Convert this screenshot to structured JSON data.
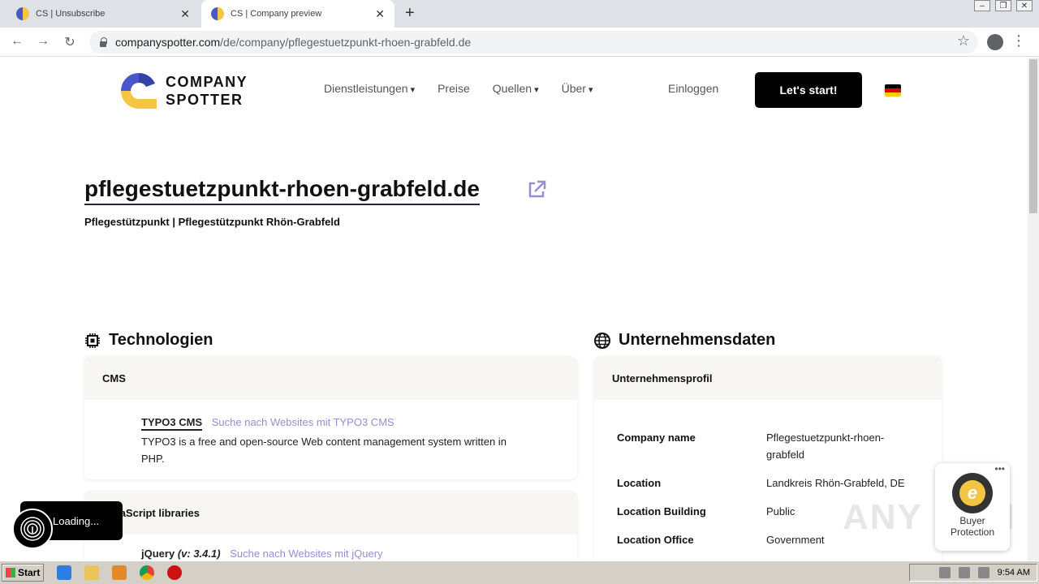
{
  "browser": {
    "tabs": [
      {
        "title": "CS | Unsubscribe"
      },
      {
        "title": "CS | Company preview"
      }
    ],
    "url_host": "companyspotter.com",
    "url_path": "/de/company/pflegestuetzpunkt-rhoen-grabfeld.de"
  },
  "header": {
    "logo_line1": "COMPANY",
    "logo_line2": "SPOTTER",
    "nav": {
      "services": "Dienstleistungen",
      "pricing": "Preise",
      "sources": "Quellen",
      "about": "Über"
    },
    "login": "Einloggen",
    "cta": "Let's start!"
  },
  "company": {
    "domain": "pflegestuetzpunkt-rhoen-grabfeld.de",
    "subtitle": "Pflegestützpunkt | Pflegestützpunkt Rhön-Grabfeld"
  },
  "technologies": {
    "title": "Technologien",
    "cards": [
      {
        "category": "CMS",
        "name": "TYPO3 CMS",
        "link": "Suche nach Websites mit TYPO3 CMS",
        "description": "TYPO3 is a free and open-source Web content management system written in PHP."
      },
      {
        "category": "JavaScript libraries",
        "name": "jQuery",
        "version": "(v: 3.4.1)",
        "link": "Suche nach Websites mit jQuery"
      }
    ]
  },
  "company_data": {
    "title": "Unternehmensdaten",
    "profile_title": "Unternehmensprofil",
    "rows": [
      {
        "key": "Company name",
        "value": "Pflegestuetzpunkt-rhoen-grabfeld"
      },
      {
        "key": "Location",
        "value": "Landkreis Rhön-Grabfeld, DE"
      },
      {
        "key": "Location Building",
        "value": "Public"
      },
      {
        "key": "Location Office",
        "value": "Government"
      }
    ]
  },
  "overlays": {
    "loading": "Loading...",
    "trusted_line1": "Buyer",
    "trusted_line2": "Protection",
    "watermark": "ANY RUN"
  },
  "taskbar": {
    "start": "Start",
    "clock": "9:54 AM"
  },
  "colors": {
    "accent_purple": "#9b8ad6",
    "logo_blue": "#4a57c9",
    "logo_yellow": "#f4c542",
    "cta_bg": "#000000"
  }
}
